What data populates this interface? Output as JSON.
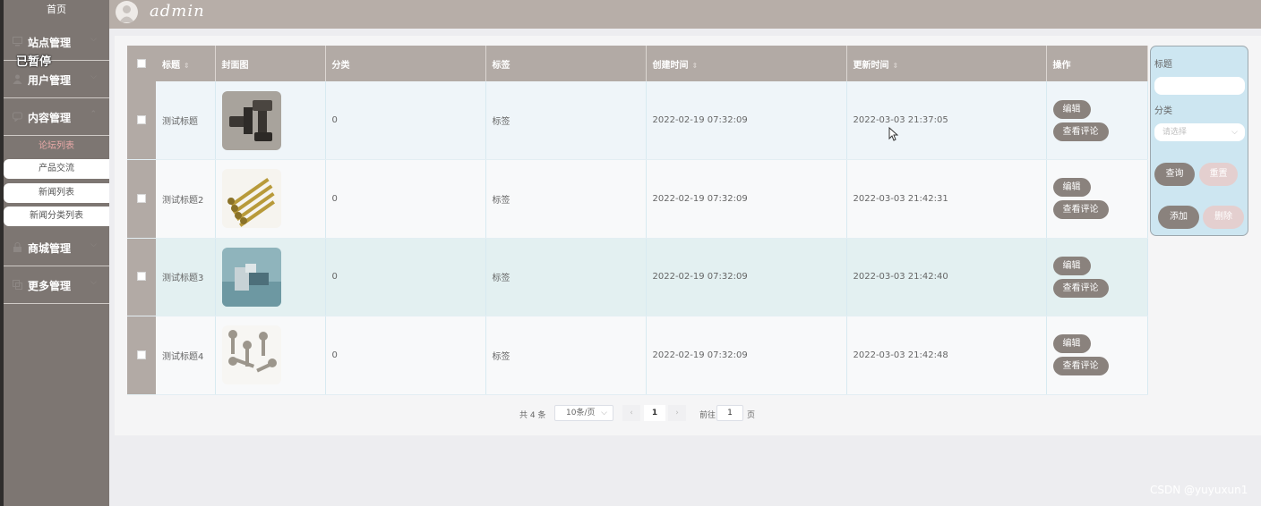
{
  "sidebar": {
    "home": "首页",
    "groups": [
      {
        "label": "站点管理"
      },
      {
        "label": "用户管理"
      },
      {
        "label": "内容管理"
      },
      {
        "label": "商城管理"
      },
      {
        "label": "更多管理"
      }
    ],
    "sub_items": [
      {
        "label": "论坛列表"
      },
      {
        "label": "产品交流"
      },
      {
        "label": "新闻列表"
      },
      {
        "label": "新闻分类列表"
      }
    ],
    "overlay_text": "已暂停"
  },
  "header": {
    "username": "admin"
  },
  "table": {
    "columns": {
      "title": "标题",
      "cover": "封面图",
      "category": "分类",
      "tags": "标签",
      "created": "创建时间",
      "updated": "更新时间",
      "actions": "操作"
    },
    "rows": [
      {
        "title": "测试标题",
        "category": "0",
        "tags": "标签",
        "created": "2022-02-19 07:32:09",
        "updated": "2022-03-03 21:37:05",
        "edit": "编辑",
        "view": "查看评论"
      },
      {
        "title": "测试标题2",
        "category": "0",
        "tags": "标签",
        "created": "2022-02-19 07:32:09",
        "updated": "2022-03-03 21:42:31",
        "edit": "编辑",
        "view": "查看评论"
      },
      {
        "title": "测试标题3",
        "category": "0",
        "tags": "标签",
        "created": "2022-02-19 07:32:09",
        "updated": "2022-03-03 21:42:40",
        "edit": "编辑",
        "view": "查看评论"
      },
      {
        "title": "测试标题4",
        "category": "0",
        "tags": "标签",
        "created": "2022-02-19 07:32:09",
        "updated": "2022-03-03 21:42:48",
        "edit": "编辑",
        "view": "查看评论"
      }
    ]
  },
  "pagination": {
    "total": "共 4 条",
    "page_size": "10条/页",
    "current_page": "1",
    "goto_label": "前往",
    "goto_value": "1",
    "page_suffix": "页"
  },
  "search": {
    "title_label": "标题",
    "category_label": "分类",
    "category_placeholder": "请选择",
    "query_button": "查询",
    "reset_button": "重置",
    "add_button": "添加",
    "delete_button": "删除"
  },
  "watermark": "CSDN @yuyuxun1",
  "colors": {
    "sidebar": "#7d7672",
    "header": "#b7aea8",
    "table_header": "#b2aaa5",
    "button": "#8a827d",
    "search_panel": "#cde6f1"
  }
}
